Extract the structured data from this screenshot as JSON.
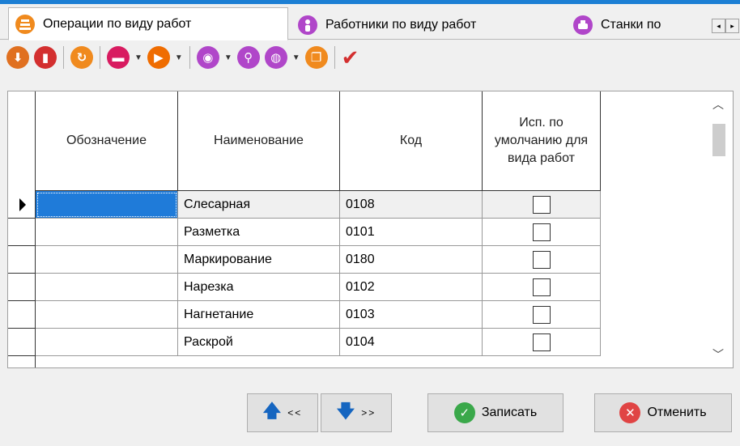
{
  "tabs": [
    {
      "label": "Операции по виду работ",
      "icon": "operations-icon",
      "active": true
    },
    {
      "label": "Работники по виду работ",
      "icon": "worker-icon",
      "active": false
    },
    {
      "label": "Станки по",
      "icon": "machine-icon",
      "active": false
    }
  ],
  "tab_scroll": {
    "left": "◂",
    "right": "▸"
  },
  "toolbar": {
    "items": [
      {
        "name": "download-icon",
        "color": "#e07020",
        "glyph": "⬇"
      },
      {
        "name": "delete-icon",
        "color": "#d32f2f",
        "glyph": "▮"
      },
      {
        "name": "refresh-icon",
        "color": "#f08a1e",
        "glyph": "↻"
      },
      {
        "name": "print-icon",
        "color": "#d81b60",
        "glyph": "▬"
      },
      {
        "name": "play-icon",
        "color": "#ef6c00",
        "glyph": "▶"
      },
      {
        "name": "view-icon",
        "color": "#b046c9",
        "glyph": "◉"
      },
      {
        "name": "search-icon",
        "color": "#b046c9",
        "glyph": "⚲"
      },
      {
        "name": "globe-icon",
        "color": "#b046c9",
        "glyph": "◍"
      },
      {
        "name": "copy-icon",
        "color": "#f08a1e",
        "glyph": "❐"
      },
      {
        "name": "checkmark-icon",
        "color": "#d32f2f",
        "glyph": "✔"
      }
    ]
  },
  "grid": {
    "columns": [
      "Обозначение",
      "Наименование",
      "Код",
      "Исп. по умолчанию для вида работ"
    ],
    "rows": [
      {
        "designation": "",
        "name": "Слесарная",
        "code": "0108",
        "default": false
      },
      {
        "designation": "",
        "name": "Разметка",
        "code": "0101",
        "default": false
      },
      {
        "designation": "",
        "name": "Маркирование",
        "code": "0180",
        "default": false
      },
      {
        "designation": "",
        "name": "Нарезка",
        "code": "0102",
        "default": false
      },
      {
        "designation": "",
        "name": "Нагнетание",
        "code": "0103",
        "default": false
      },
      {
        "designation": "",
        "name": "Раскрой",
        "code": "0104",
        "default": false
      }
    ]
  },
  "buttons": {
    "prev": "<<",
    "next": ">>",
    "save": "Записать",
    "cancel": "Отменить"
  },
  "colors": {
    "accent": "#1c7fd4",
    "selected_cell": "#1f7bd9",
    "save_icon": "#3aa84a",
    "cancel_icon": "#e04444"
  }
}
